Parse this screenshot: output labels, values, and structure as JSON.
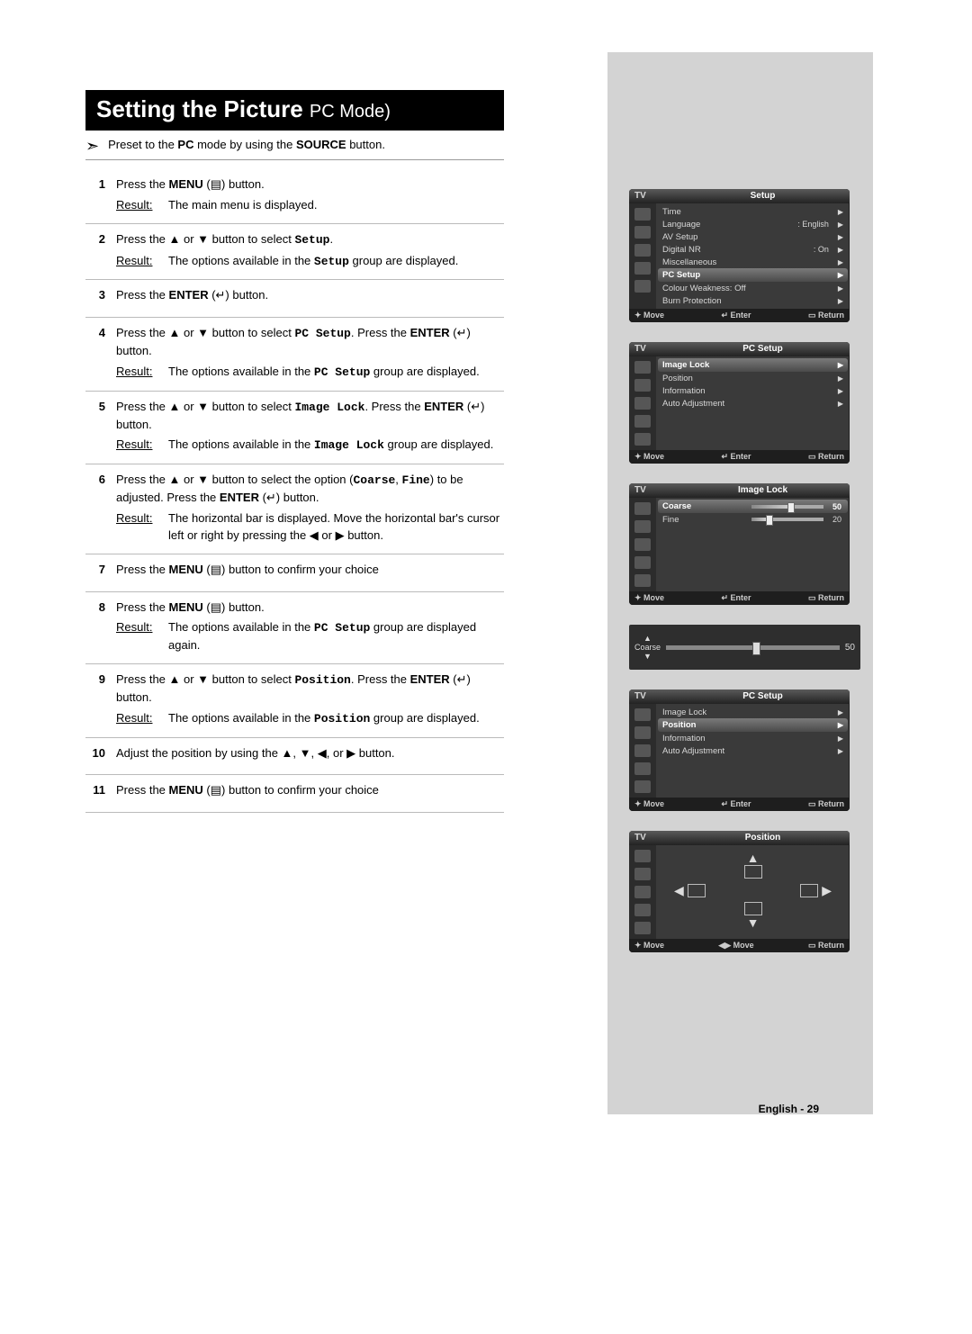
{
  "title": {
    "main": "Setting the Picture ",
    "sub": "PC Mode)"
  },
  "preset": "Preset to the PC mode by using the SOURCE button.",
  "result_label": "Result:",
  "steps": [
    {
      "n": "1",
      "text": "Press the MENU (▤) button.",
      "result": "The main menu is displayed."
    },
    {
      "n": "2",
      "text": "Press the ▲ or ▼ button to select Setup.",
      "result": "The options available in the Setup group are displayed."
    },
    {
      "n": "3",
      "text": "Press the ENTER (↵) button."
    },
    {
      "n": "4",
      "text": "Press the ▲ or ▼ button to select PC Setup. Press the ENTER (↵) button.",
      "result": "The options available in the PC Setup group are displayed."
    },
    {
      "n": "5",
      "text": "Press the ▲ or ▼ button to select Image Lock. Press the ENTER (↵) button.",
      "result": "The options available in the Image Lock group are displayed."
    },
    {
      "n": "6",
      "text": "Press the ▲ or ▼ button to select the option (Coarse, Fine) to be adjusted. Press the ENTER (↵) button.",
      "result": "The horizontal bar is displayed. Move the horizontal bar's cursor left or right by pressing the ◀ or ▶ button."
    },
    {
      "n": "7",
      "text": "Press the MENU (▤) button to confirm your choice"
    },
    {
      "n": "8",
      "text": "Press the MENU (▤) button.",
      "result": "The options available in the PC Setup group are displayed again."
    },
    {
      "n": "9",
      "text": "Press the ▲ or ▼ button to select Position. Press the ENTER (↵) button.",
      "result": "The options available in the Position group are displayed."
    },
    {
      "n": "10",
      "text": "Adjust the position by using the ▲, ▼, ◀, or ▶ button."
    },
    {
      "n": "11",
      "text": "Press the MENU (▤) button to confirm your choice"
    }
  ],
  "osd": {
    "tv": "TV",
    "footer": {
      "move": "Move",
      "enter": "Enter",
      "ret": "Return"
    },
    "footer_lr": "Move",
    "setup": {
      "title": "Setup",
      "items": [
        {
          "label": "Time"
        },
        {
          "label": "Language",
          "value": ": English"
        },
        {
          "label": "AV Setup"
        },
        {
          "label": "Digital NR",
          "value": ": On"
        },
        {
          "label": "Miscellaneous"
        },
        {
          "label": "PC Setup",
          "sel": true
        },
        {
          "label": "Colour Weakness: Off"
        },
        {
          "label": "Burn Protection"
        }
      ]
    },
    "pcsetup": {
      "title": "PC Setup",
      "items": [
        {
          "label": "Image Lock",
          "sel": true
        },
        {
          "label": "Position"
        },
        {
          "label": "Information"
        },
        {
          "label": "Auto Adjustment"
        }
      ]
    },
    "imagelock": {
      "title": "Image Lock",
      "items": [
        {
          "label": "Coarse",
          "slider": 50,
          "sel": true
        },
        {
          "label": "Fine",
          "slider": 20
        }
      ]
    },
    "coarse": {
      "label": "Coarse",
      "value": "50"
    },
    "pcsetup2": {
      "title": "PC Setup",
      "items": [
        {
          "label": "Image Lock"
        },
        {
          "label": "Position",
          "sel": true
        },
        {
          "label": "Information"
        },
        {
          "label": "Auto Adjustment"
        }
      ]
    },
    "position": {
      "title": "Position"
    }
  },
  "page_footer": "English - 29"
}
